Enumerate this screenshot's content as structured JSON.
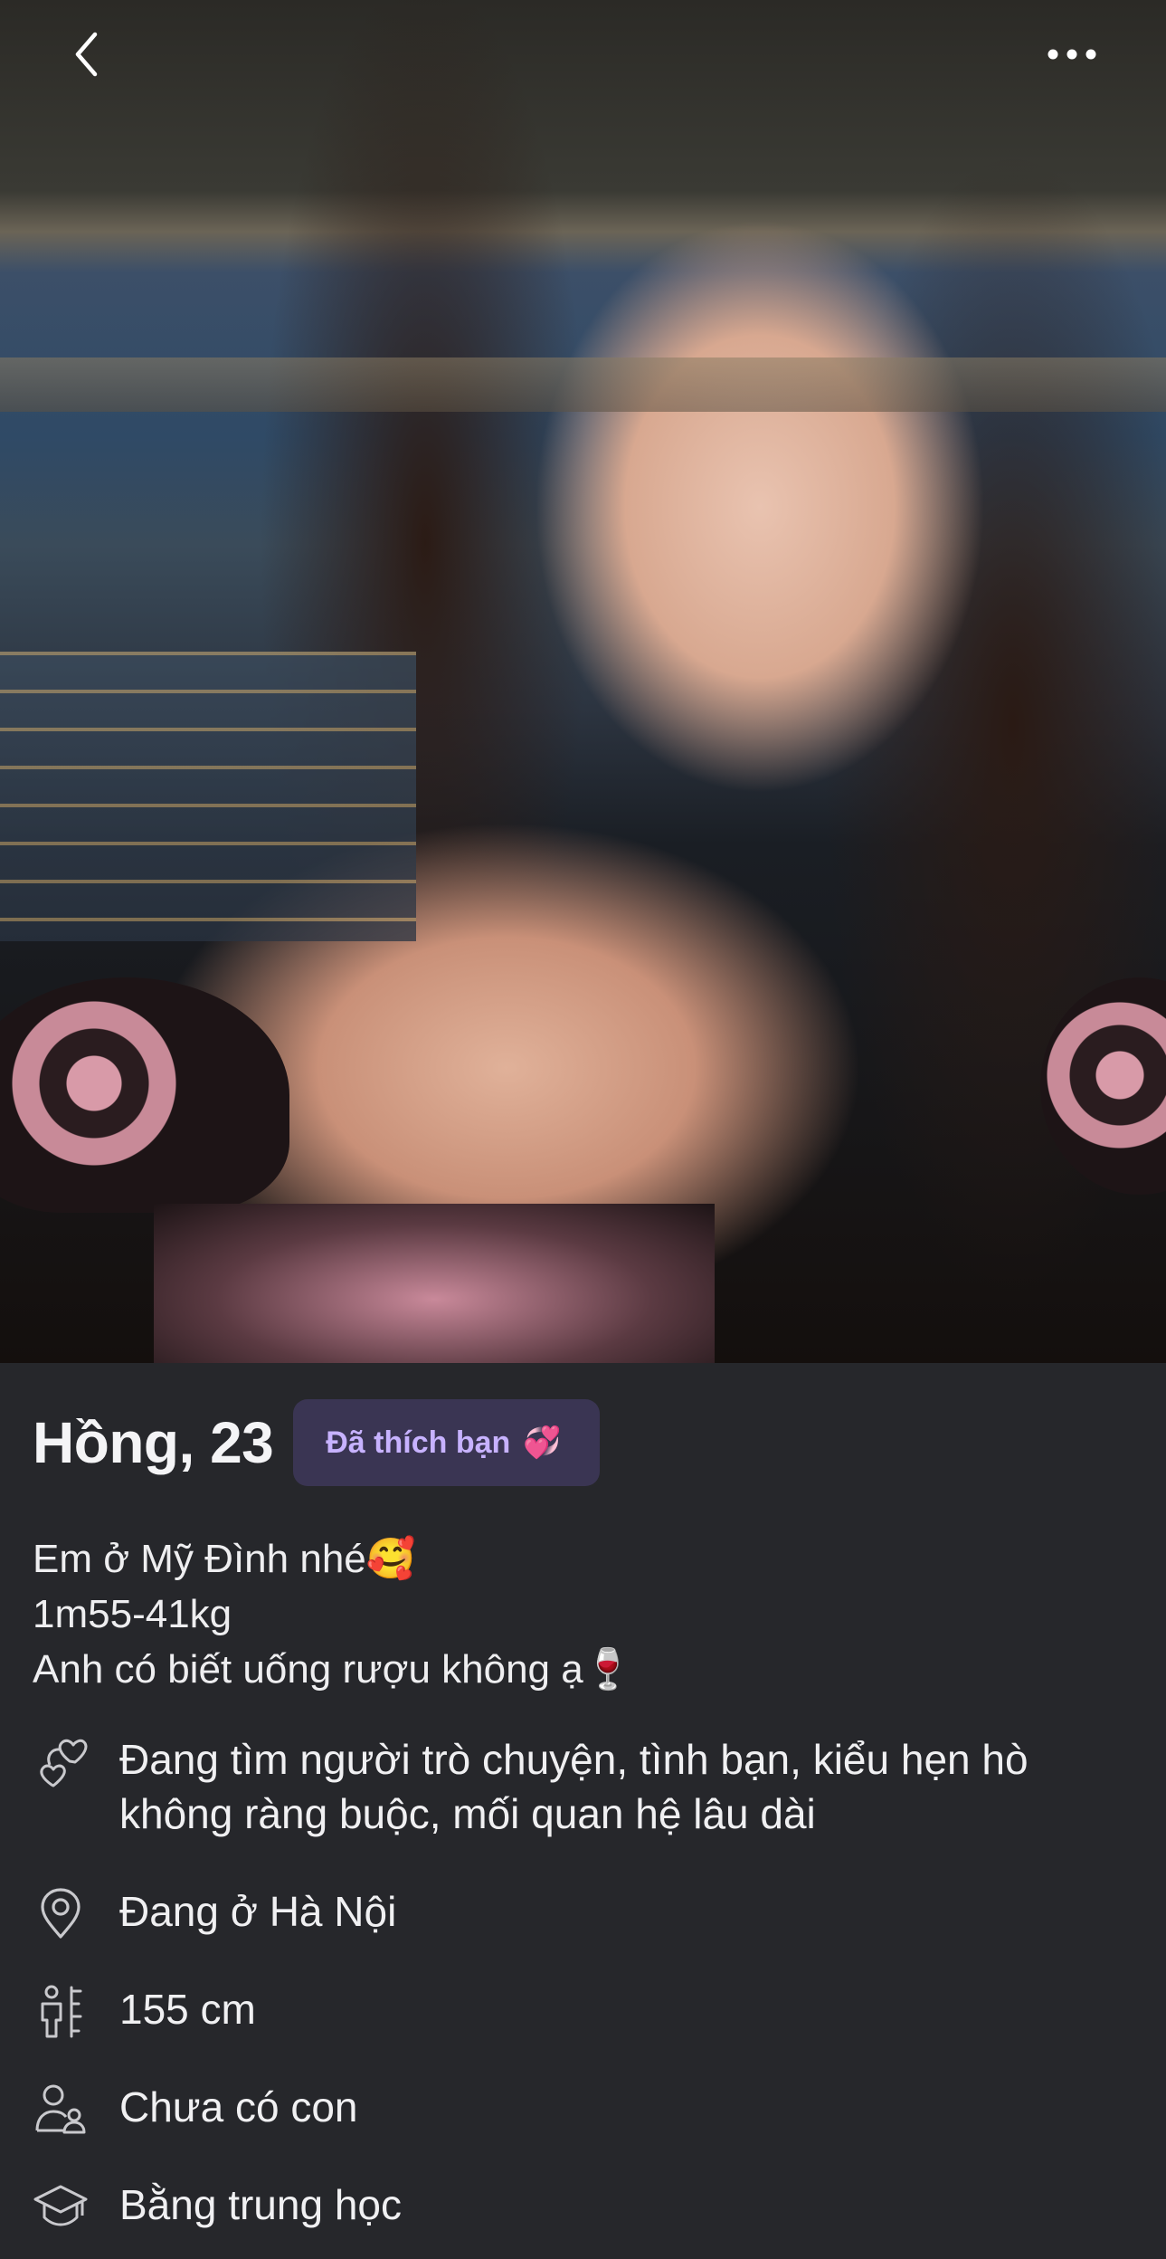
{
  "nav": {
    "back_icon": "chevron-left-icon",
    "more_icon": "more-horizontal-icon"
  },
  "profile": {
    "name_age": "Hồng, 23",
    "liked_badge": {
      "label": "Đã thích bạn",
      "emoji": "💞"
    },
    "bio_lines": [
      "Em ở Mỹ Đình nhé🥰",
      "1m55-41kg",
      "Anh có biết uống rượu không ạ🍷"
    ],
    "facts": [
      {
        "icon": "hearts-icon",
        "text": "Đang tìm người trò chuyện, tình bạn, kiểu hẹn hò không ràng buộc, mối quan hệ lâu dài"
      },
      {
        "icon": "location-pin-icon",
        "text": "Đang ở Hà Nội"
      },
      {
        "icon": "height-icon",
        "text": "155 cm"
      },
      {
        "icon": "children-icon",
        "text": "Chưa có con"
      },
      {
        "icon": "education-icon",
        "text": "Bằng trung học"
      }
    ]
  },
  "colors": {
    "background": "#26272b",
    "badge_bg": "#3a3553",
    "badge_text": "#c7b2ff",
    "text": "#f2f2f4"
  }
}
